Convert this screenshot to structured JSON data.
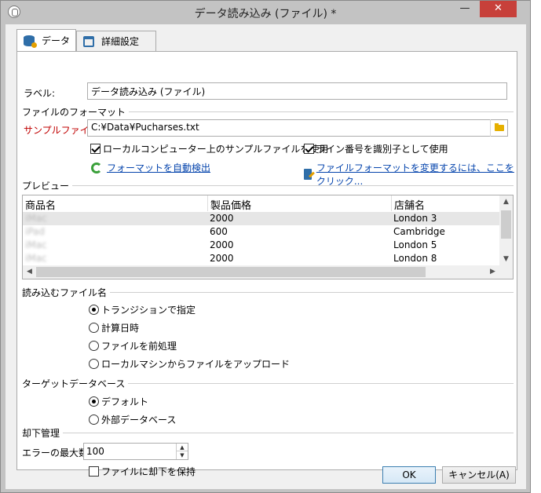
{
  "window": {
    "title": "データ読み込み (ファイル) *",
    "minimize_glyph": "—",
    "close_glyph": "✕"
  },
  "tabs": [
    {
      "label": "データ",
      "icon": "database-icon"
    },
    {
      "label": "詳細設定",
      "icon": "clipboard-icon"
    }
  ],
  "label_field": {
    "label": "ラベル:",
    "value": "データ読み込み (ファイル)"
  },
  "file_format": {
    "section_title": "ファイルのフォーマット",
    "sample_file_label": "サンプルファイル:",
    "sample_file_value": "C:¥Data¥Pucharses.txt",
    "use_local_sample_label": "ローカルコンピューター上のサンプルファイルを使用",
    "use_local_sample_checked": true,
    "line_number_id_label": "ライン番号を識別子として使用",
    "line_number_id_checked": true,
    "autodetect_link": "フォーマットを自動検出",
    "change_format_link": "ファイルフォーマットを変更するには、ここをクリック..."
  },
  "preview": {
    "section_title": "プレビュー",
    "columns": [
      "商品名",
      "製品価格",
      "店舗名"
    ],
    "rows": [
      [
        "iMac",
        "2000",
        "London 3"
      ],
      [
        "iPad",
        "600",
        "Cambridge"
      ],
      [
        "iMac",
        "2000",
        "London 5"
      ],
      [
        "iMac",
        "2000",
        "London 8"
      ]
    ]
  },
  "file_to_load": {
    "section_title": "読み込むファイル名",
    "options": [
      {
        "label": "トランジションで指定",
        "selected": true
      },
      {
        "label": "計算日時",
        "selected": false
      },
      {
        "label": "ファイルを前処理",
        "selected": false
      },
      {
        "label": "ローカルマシンからファイルをアップロード",
        "selected": false
      }
    ]
  },
  "target_db": {
    "section_title": "ターゲットデータベース",
    "options": [
      {
        "label": "デフォルト",
        "selected": true
      },
      {
        "label": "外部データベース",
        "selected": false
      }
    ]
  },
  "rejects": {
    "section_title": "却下管理",
    "max_errors_label": "エラーの最大数:",
    "max_errors_value": "100",
    "keep_rejects_label": "ファイルに却下を保持",
    "keep_rejects_checked": false
  },
  "buttons": {
    "ok": "OK",
    "cancel": "キャンセル(A)"
  },
  "colors": {
    "required_label": "#c00000",
    "link": "#0645ad",
    "close_button": "#c7403a"
  }
}
